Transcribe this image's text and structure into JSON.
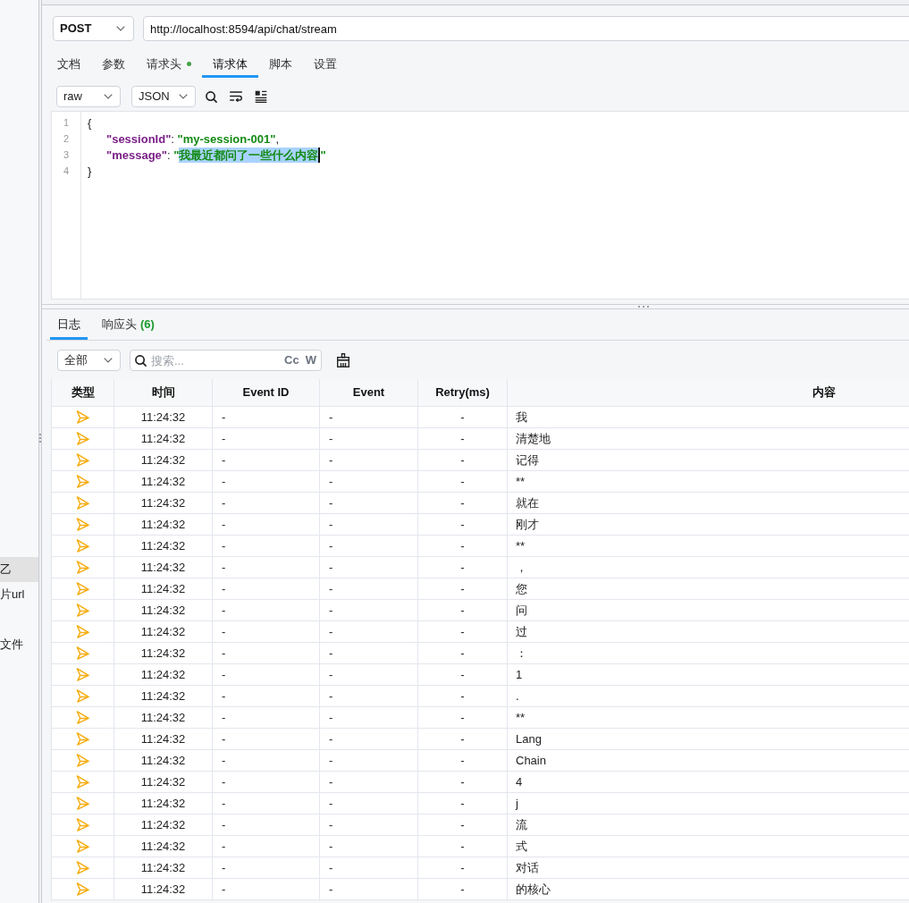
{
  "sidebar": {
    "items": [
      {
        "label": "乙",
        "selected": true
      },
      {
        "label": "片url",
        "selected": false
      },
      {
        "label": "文件",
        "selected": false
      }
    ]
  },
  "request": {
    "method": "POST",
    "url": "http://localhost:8594/api/chat/stream"
  },
  "request_tabs": [
    {
      "label": "文档",
      "selected": false,
      "dot": false
    },
    {
      "label": "参数",
      "selected": false,
      "dot": false
    },
    {
      "label": "请求头",
      "selected": false,
      "dot": true
    },
    {
      "label": "请求体",
      "selected": true,
      "dot": false
    },
    {
      "label": "脚本",
      "selected": false,
      "dot": false
    },
    {
      "label": "设置",
      "selected": false,
      "dot": false
    }
  ],
  "body_toolbar": {
    "mode": "raw",
    "format": "JSON"
  },
  "editor": {
    "lines": [
      {
        "number": "1",
        "indented": false,
        "tokens": [
          {
            "kind": "punct",
            "text": "{",
            "selected": false
          }
        ]
      },
      {
        "number": "2",
        "indented": true,
        "tokens": [
          {
            "kind": "key",
            "text": "\"sessionId\"",
            "selected": false
          },
          {
            "kind": "punct",
            "text": ": ",
            "selected": false
          },
          {
            "kind": "string",
            "text": "\"my-session-001\"",
            "selected": false
          },
          {
            "kind": "punct",
            "text": ",",
            "selected": false
          }
        ]
      },
      {
        "number": "3",
        "indented": true,
        "tokens": [
          {
            "kind": "key",
            "text": "\"message\"",
            "selected": false
          },
          {
            "kind": "punct",
            "text": ": ",
            "selected": false
          },
          {
            "kind": "string",
            "text": "\"",
            "selected": false
          },
          {
            "kind": "string",
            "text": "我最近都问了一些什么内容",
            "selected": true
          },
          {
            "kind": "string",
            "text": "\"",
            "selected": false
          }
        ]
      },
      {
        "number": "4",
        "indented": false,
        "tokens": [
          {
            "kind": "punct",
            "text": "}",
            "selected": false
          }
        ]
      }
    ]
  },
  "response_tabs": [
    {
      "label": "日志",
      "selected": true
    },
    {
      "label": "响应头",
      "count": "(6)",
      "selected": false
    }
  ],
  "log_toolbar": {
    "filter": "全部",
    "search_placeholder": "搜索...",
    "toggles": [
      {
        "label": "Cc",
        "on": false
      },
      {
        "label": "W",
        "on": false
      }
    ]
  },
  "table": {
    "columns": [
      "类型",
      "时间",
      "Event ID",
      "Event",
      "Retry(ms)",
      "内容"
    ],
    "rows": [
      {
        "time": "11:24:32",
        "event_id": "-",
        "event": "-",
        "retry": "-",
        "content": "我"
      },
      {
        "time": "11:24:32",
        "event_id": "-",
        "event": "-",
        "retry": "-",
        "content": "清楚地"
      },
      {
        "time": "11:24:32",
        "event_id": "-",
        "event": "-",
        "retry": "-",
        "content": "记得"
      },
      {
        "time": "11:24:32",
        "event_id": "-",
        "event": "-",
        "retry": "-",
        "content": "**"
      },
      {
        "time": "11:24:32",
        "event_id": "-",
        "event": "-",
        "retry": "-",
        "content": "就在"
      },
      {
        "time": "11:24:32",
        "event_id": "-",
        "event": "-",
        "retry": "-",
        "content": "刚才"
      },
      {
        "time": "11:24:32",
        "event_id": "-",
        "event": "-",
        "retry": "-",
        "content": "**"
      },
      {
        "time": "11:24:32",
        "event_id": "-",
        "event": "-",
        "retry": "-",
        "content": "，"
      },
      {
        "time": "11:24:32",
        "event_id": "-",
        "event": "-",
        "retry": "-",
        "content": "您"
      },
      {
        "time": "11:24:32",
        "event_id": "-",
        "event": "-",
        "retry": "-",
        "content": "问"
      },
      {
        "time": "11:24:32",
        "event_id": "-",
        "event": "-",
        "retry": "-",
        "content": "过"
      },
      {
        "time": "11:24:32",
        "event_id": "-",
        "event": "-",
        "retry": "-",
        "content": "："
      },
      {
        "time": "11:24:32",
        "event_id": "-",
        "event": "-",
        "retry": "-",
        "content": "1"
      },
      {
        "time": "11:24:32",
        "event_id": "-",
        "event": "-",
        "retry": "-",
        "content": "."
      },
      {
        "time": "11:24:32",
        "event_id": "-",
        "event": "-",
        "retry": "-",
        "content": "**"
      },
      {
        "time": "11:24:32",
        "event_id": "-",
        "event": "-",
        "retry": "-",
        "content": "Lang"
      },
      {
        "time": "11:24:32",
        "event_id": "-",
        "event": "-",
        "retry": "-",
        "content": "Chain"
      },
      {
        "time": "11:24:32",
        "event_id": "-",
        "event": "-",
        "retry": "-",
        "content": "4"
      },
      {
        "time": "11:24:32",
        "event_id": "-",
        "event": "-",
        "retry": "-",
        "content": "j"
      },
      {
        "time": "11:24:32",
        "event_id": "-",
        "event": "-",
        "retry": "-",
        "content": "流"
      },
      {
        "time": "11:24:32",
        "event_id": "-",
        "event": "-",
        "retry": "-",
        "content": "式"
      },
      {
        "time": "11:24:32",
        "event_id": "-",
        "event": "-",
        "retry": "-",
        "content": "对话"
      },
      {
        "time": "11:24:32",
        "event_id": "-",
        "event": "-",
        "retry": "-",
        "content": "的核心"
      }
    ]
  }
}
